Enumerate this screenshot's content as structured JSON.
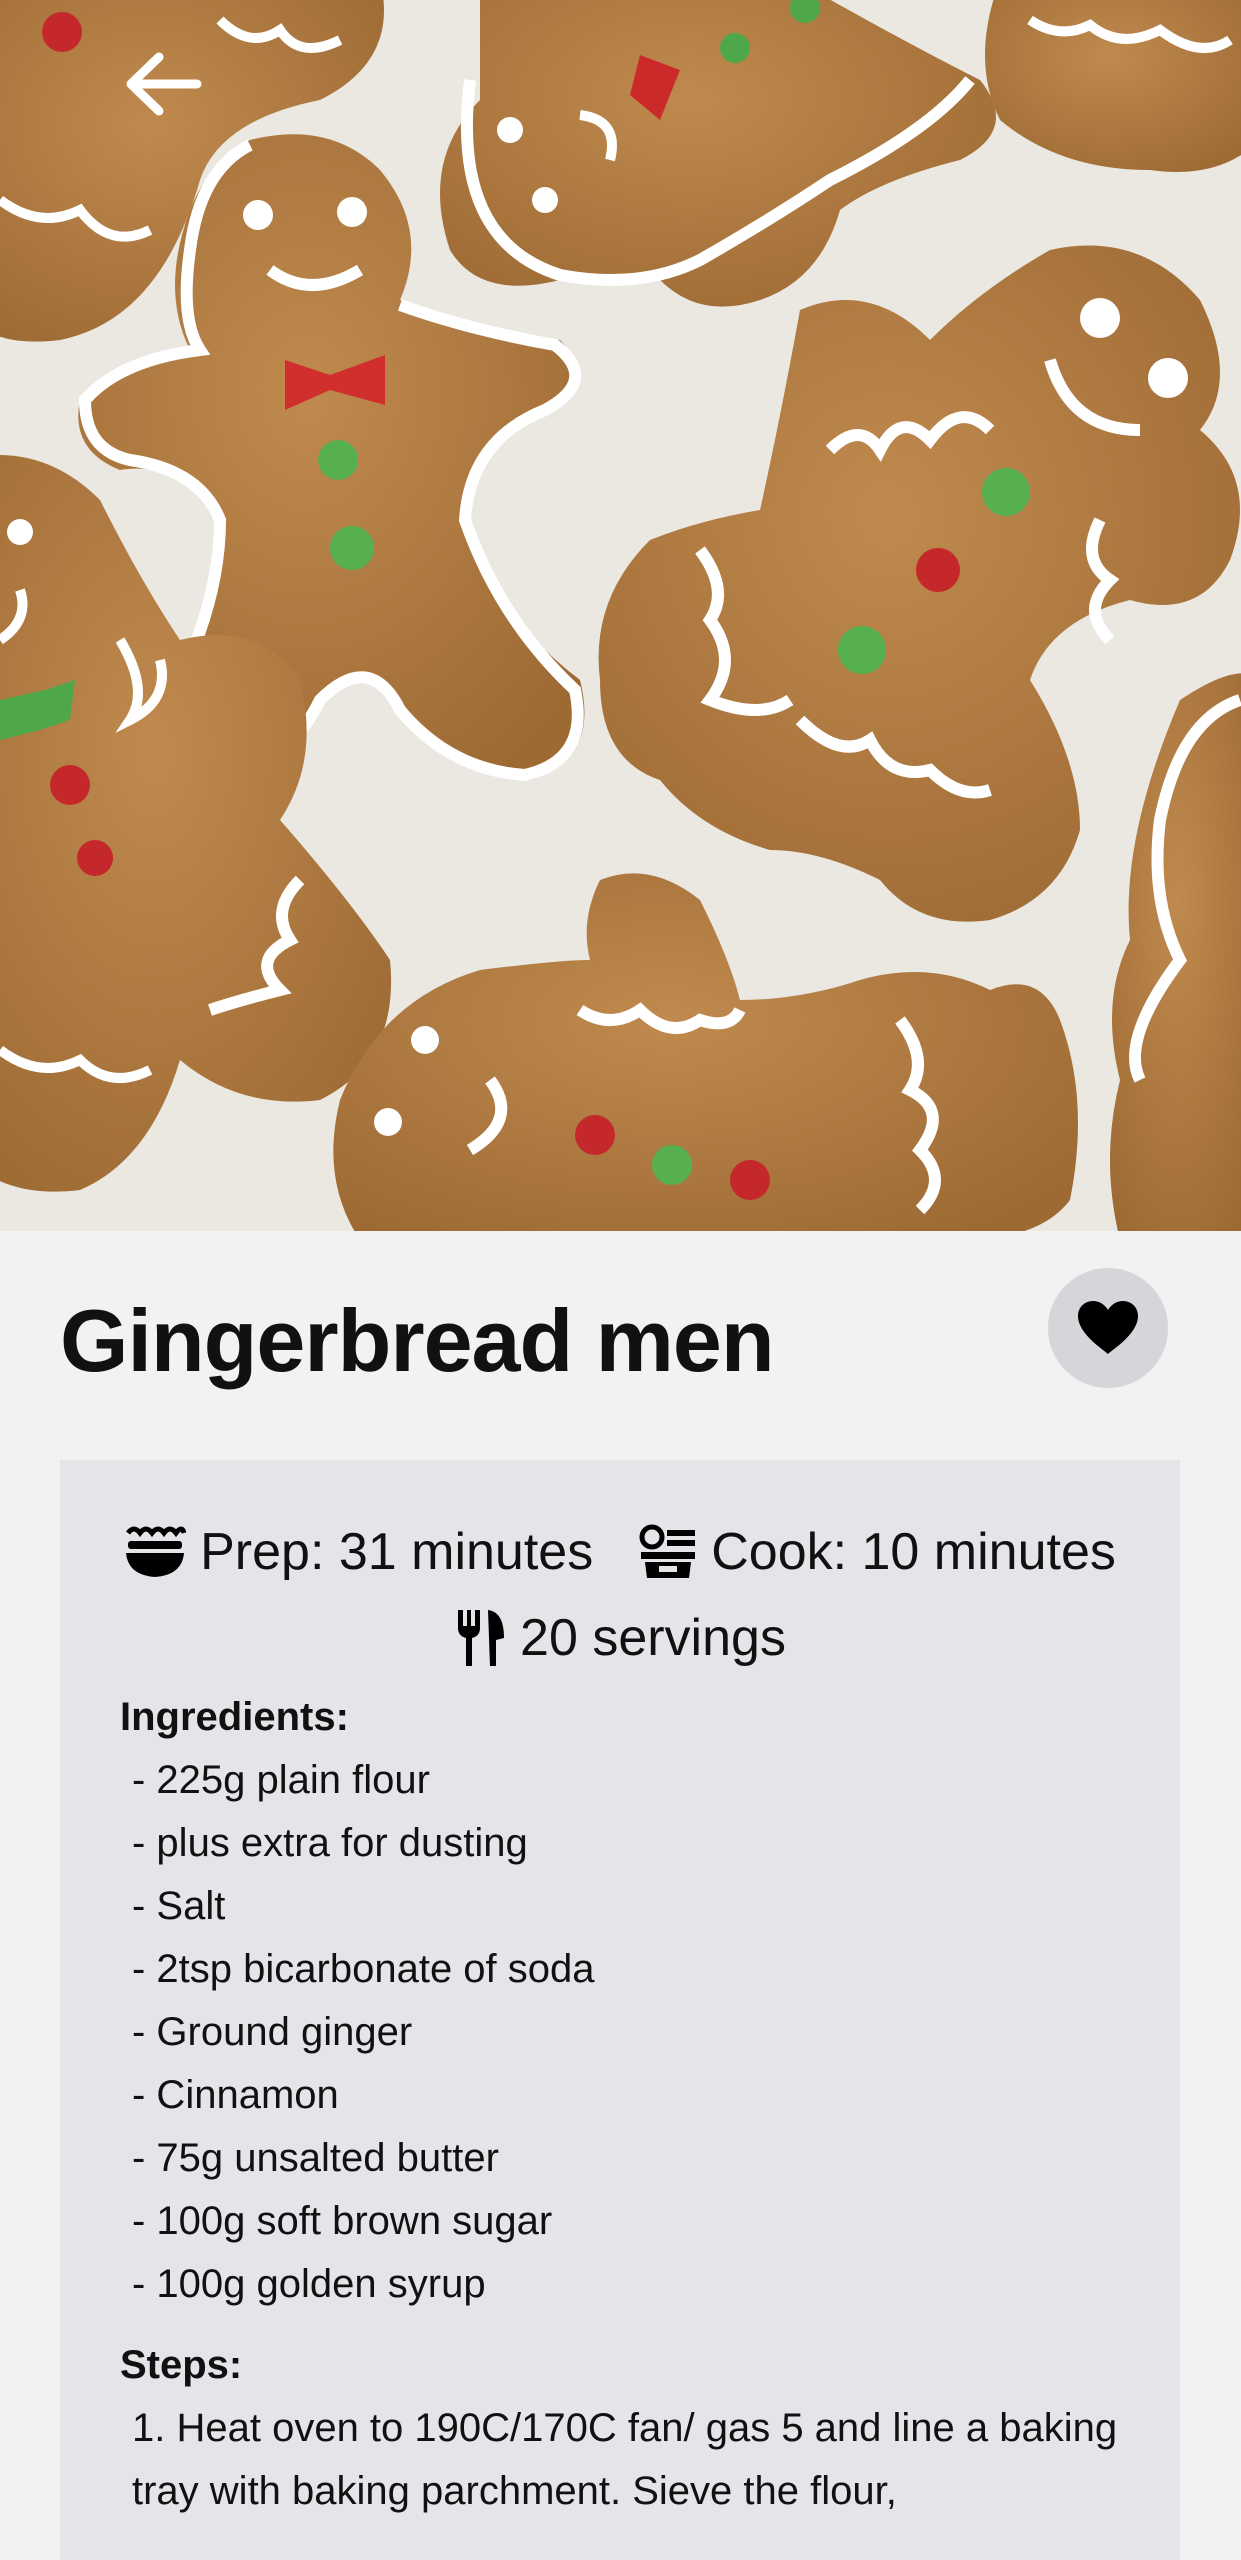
{
  "header": {
    "back_icon": "arrow-left-icon",
    "hero_image": "gingerbread-men-photo"
  },
  "recipe": {
    "title": "Gingerbread men",
    "favorite_icon": "heart-icon",
    "prep_icon": "prep-icon",
    "prep": "Prep: 31 minutes",
    "cook_icon": "cooking-pot-icon",
    "cook": "Cook: 10 minutes",
    "servings_icon": "utensils-icon",
    "servings": "20 servings",
    "ingredients_label": "Ingredients:",
    "ingredients": [
      " - 225g plain flour",
      " -  plus extra for dusting",
      " - Salt",
      " - 2tsp bicarbonate of soda",
      " - Ground ginger",
      " - Cinnamon",
      " - 75g unsalted butter",
      " - 100g soft brown sugar",
      " - 100g golden syrup"
    ],
    "steps_label": "Steps:",
    "steps_text": " 1. Heat oven to 190C/170C fan/ gas 5 and line a baking tray with baking parchment. Sieve the flour,"
  },
  "colors": {
    "background": "#f2f2f2",
    "card": "#e4e5e9",
    "fav_button": "#d6d6da",
    "text": "#111111"
  }
}
